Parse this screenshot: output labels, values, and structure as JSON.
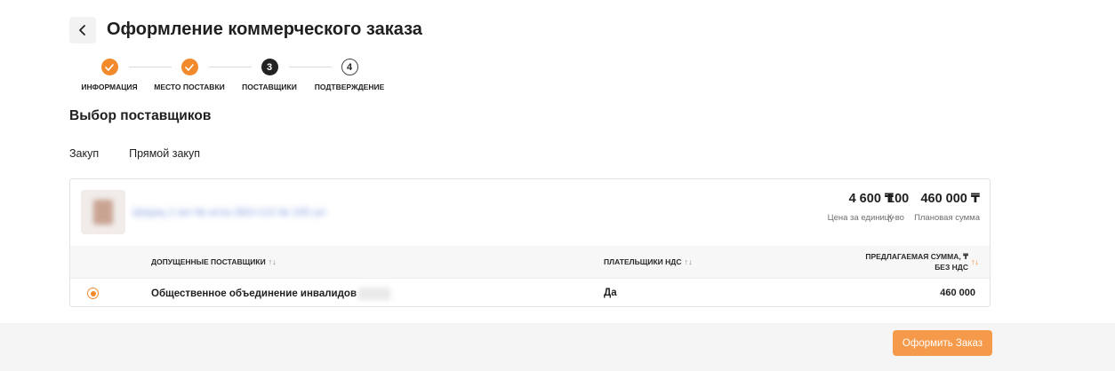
{
  "header": {
    "title": "Оформление коммерческого заказа"
  },
  "stepper": {
    "steps": [
      {
        "num": "1",
        "label": "ИНФОРМАЦИЯ",
        "state": "done"
      },
      {
        "num": "2",
        "label": "МЕСТО ПОСТАВКИ",
        "state": "done"
      },
      {
        "num": "3",
        "label": "ПОСТАВЩИКИ",
        "state": "active"
      },
      {
        "num": "4",
        "label": "ПОДТВЕРЖДЕНИЕ",
        "state": "todo"
      }
    ]
  },
  "section": {
    "title": "Выбор поставщиков"
  },
  "purchase_type": {
    "left_label": "Закуп",
    "right_label": "Прямой закуп"
  },
  "product": {
    "name_blurred": "Шприц 1 мл № игла 26G×1/2 № 100 шт",
    "unit_price": "4 600 ₸",
    "unit_price_caption": "Цена за единицу",
    "quantity": "100",
    "quantity_caption": "К-во",
    "planned_sum": "460 000 ₸",
    "planned_sum_caption": "Плановая сумма"
  },
  "table": {
    "columns": {
      "suppliers": "ДОПУЩЕННЫЕ ПОСТАВЩИКИ",
      "vat_payers": "ПЛАТЕЛЬЩИКИ НДС",
      "proposed_sum_line1": "ПРЕДЛАГАЕМАЯ СУММА, ₸",
      "proposed_sum_line2": "БЕЗ НДС"
    },
    "sort_icon": "↑↓",
    "rows": [
      {
        "supplier": "Общественное объединение инвалидов",
        "vat": "Да",
        "sum": "460 000",
        "selected": true
      }
    ]
  },
  "footer": {
    "submit_label": "Оформить Заказ"
  },
  "colors": {
    "accent": "#f28a2c",
    "button": "#f5994a",
    "dark": "#222222"
  }
}
